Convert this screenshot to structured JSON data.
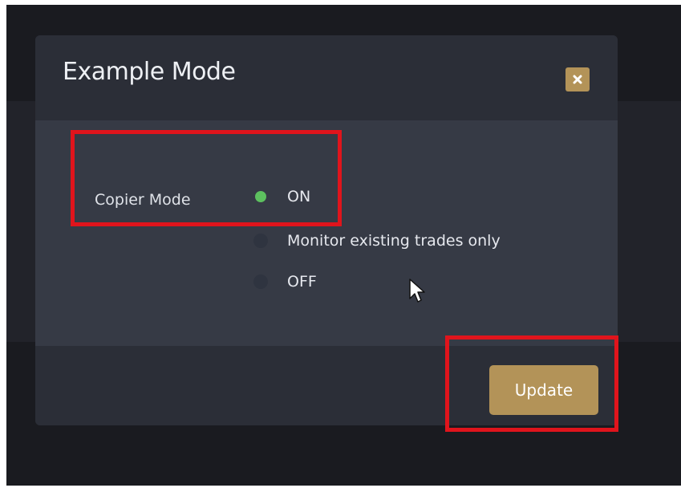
{
  "modal": {
    "title": "Example Mode",
    "close_icon": "close-icon"
  },
  "form": {
    "field_label": "Copier Mode",
    "options": [
      {
        "label": "ON",
        "selected": true
      },
      {
        "label": "Monitor existing trades only",
        "selected": false
      },
      {
        "label": "OFF",
        "selected": false
      }
    ]
  },
  "footer": {
    "update_label": "Update"
  },
  "colors": {
    "accent": "#b39358",
    "selected_radio": "#5dc05f",
    "highlight_box": "#e0141c"
  }
}
